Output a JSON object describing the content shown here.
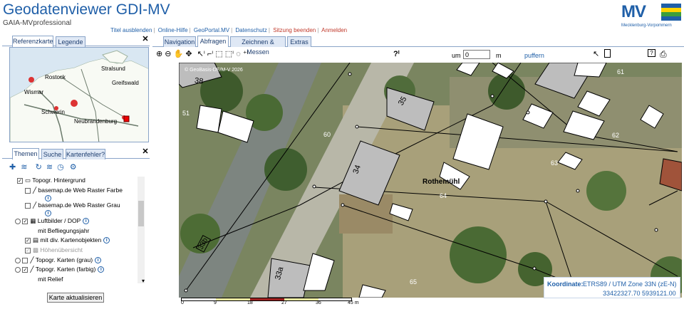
{
  "header": {
    "title": "Geodatenviewer GDI-MV",
    "subtitle": "GAIA-MVprofessional",
    "logo_text": "MV",
    "logo_sub": "Mecklenburg-Vorpommern"
  },
  "toplinks": [
    {
      "label": "Titel ausblenden"
    },
    {
      "label": "Online-Hilfe"
    },
    {
      "label": "GeoPortal.MV"
    },
    {
      "label": "Datenschutz"
    },
    {
      "label": "Sitzung beenden"
    },
    {
      "label": "Anmelden"
    }
  ],
  "left_tabs": {
    "ref": "Referenzkarte",
    "legend": "Legende"
  },
  "refmap": {
    "cities": [
      "Rostock",
      "Stralsund",
      "Greifswald",
      "Wismar",
      "Schwerin",
      "Neubrandenburg"
    ]
  },
  "theme_tabs": {
    "themen": "Themen",
    "suche": "Suche",
    "fehler": "Kartenfehler?"
  },
  "layers": [
    {
      "label": "Topogr. Hintergrund",
      "checked": true
    },
    {
      "label": "basemap.de Web Raster Farbe",
      "checked": false
    },
    {
      "label": "basemap.de Web Raster Grau",
      "checked": false
    },
    {
      "label": "Luftbilder / DOP",
      "checked": true
    },
    {
      "label": "mit Befliegungsjahr",
      "checked": false
    },
    {
      "label": "mit div. Kartenobjekten",
      "checked": true
    },
    {
      "label": "Höhenübersicht",
      "checked": true
    },
    {
      "label": "Topogr. Karten (grau)",
      "checked": false
    },
    {
      "label": "Topogr. Karten (farbig)",
      "checked": true
    },
    {
      "label": "mit Relief",
      "checked": false
    }
  ],
  "update_button": "Karte aktualisieren",
  "map_tabs": {
    "nav": "Navigation",
    "abfr": "Abfragen",
    "zeich": "Zeichnen & Messen",
    "extras": "Extras"
  },
  "toolbar": {
    "um": "um",
    "value": "0",
    "unit": "m",
    "puffern": "puffern"
  },
  "map": {
    "copyright": "© GeoBasis-DE/M-V 2026",
    "parcels": [
      "38",
      "51",
      "35",
      "61",
      "60",
      "62",
      "34",
      "63",
      "64",
      "33b",
      "33a",
      "65"
    ],
    "place": "Rothemühl"
  },
  "scalebar": {
    "ticks": [
      "0",
      "9",
      "18",
      "27",
      "36",
      "45 m"
    ]
  },
  "coord": {
    "label": "Koordinate:",
    "system": "ETRS89 / UTM Zone 33N (zE-N)",
    "value": "33422327.70 5939121.00"
  },
  "colors": {
    "accent": "#1f5fa8",
    "link_red": "#c0392b"
  }
}
